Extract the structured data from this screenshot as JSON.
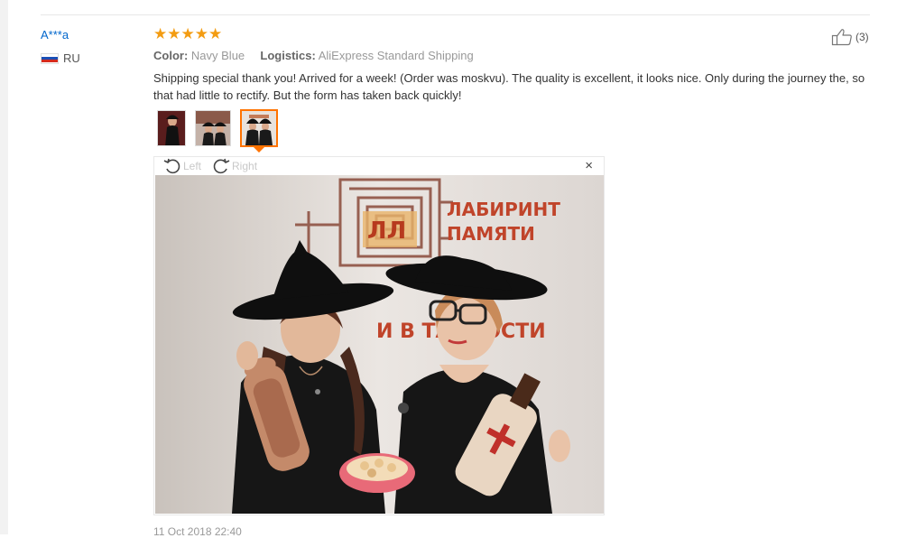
{
  "review": {
    "user_name": "A***a",
    "country_code": "RU",
    "rating_stars": 5,
    "attributes": {
      "color_label": "Color:",
      "color_value": "Navy Blue",
      "logistics_label": "Logistics:",
      "logistics_value": "AliExpress Standard Shipping"
    },
    "helpful_count": "(3)",
    "text": "Shipping special thank you! Arrived for a week! (Order was moskvu). The quality is excellent, it looks nice. Only during the journey the, so that had little to rectify. But the form has taken back quickly!",
    "date": "11 Oct 2018 22:40"
  },
  "viewer": {
    "rotate_left_label": "Left",
    "rotate_right_label": "Right",
    "close_label": "×",
    "wall_sign_line1": "ЛАБИРИНТ",
    "wall_sign_line2": "ПАМЯТИ",
    "wall_sign_line3": "И В ТАЙНОСТИ"
  },
  "icons": {
    "star": "star-icon",
    "thumb_up": "thumb-up-icon",
    "rotate_left": "rotate-left-icon",
    "rotate_right": "rotate-right-icon",
    "close": "close-icon",
    "flag": "russia-flag-icon"
  },
  "colors": {
    "star": "#f39c12",
    "link": "#0066cc",
    "accent": "#ff7300"
  }
}
